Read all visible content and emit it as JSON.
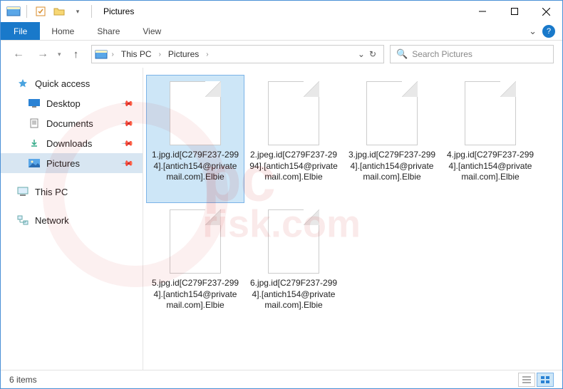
{
  "titlebar": {
    "title": "Pictures"
  },
  "ribbon": {
    "file": "File",
    "tabs": [
      "Home",
      "Share",
      "View"
    ]
  },
  "address": {
    "crumbs": [
      "This PC",
      "Pictures"
    ]
  },
  "search": {
    "placeholder": "Search Pictures"
  },
  "sidebar": {
    "quick_access": "Quick access",
    "items": [
      {
        "label": "Desktop",
        "pinned": true
      },
      {
        "label": "Documents",
        "pinned": true
      },
      {
        "label": "Downloads",
        "pinned": true
      },
      {
        "label": "Pictures",
        "pinned": true,
        "selected": true
      }
    ],
    "this_pc": "This PC",
    "network": "Network"
  },
  "files": [
    {
      "name": "1.jpg.id[C279F237-2994].[antich154@privatemail.com].Elbie",
      "selected": true
    },
    {
      "name": "2.jpeg.id[C279F237-2994].[antich154@privatemail.com].Elbie",
      "selected": false
    },
    {
      "name": "3.jpg.id[C279F237-2994].[antich154@privatemail.com].Elbie",
      "selected": false
    },
    {
      "name": "4.jpg.id[C279F237-2994].[antich154@privatemail.com].Elbie",
      "selected": false
    },
    {
      "name": "5.jpg.id[C279F237-2994].[antich154@privatemail.com].Elbie",
      "selected": false
    },
    {
      "name": "6.jpg.id[C279F237-2994].[antich154@privatemail.com].Elbie",
      "selected": false
    }
  ],
  "statusbar": {
    "count": "6 items"
  },
  "watermark": {
    "line1": "pc",
    "line2": "risk.com"
  }
}
